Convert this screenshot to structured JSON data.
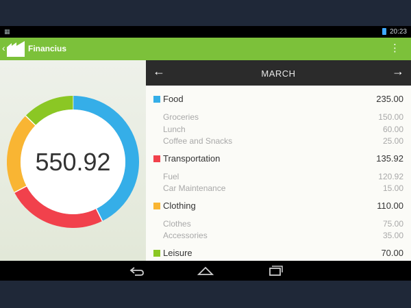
{
  "status": {
    "time": "20:23"
  },
  "app": {
    "title": "Financius"
  },
  "summary": {
    "total": "550.92"
  },
  "month": {
    "label": "MARCH"
  },
  "colors": {
    "food": "#35aee8",
    "transportation": "#f1414c",
    "clothing": "#f9b533",
    "leisure": "#8bc724",
    "action_bar": "#7cc13a"
  },
  "chart_data": {
    "type": "pie",
    "categories": [
      "Food",
      "Transportation",
      "Clothing",
      "Leisure"
    ],
    "values": [
      235.0,
      135.92,
      110.0,
      70.0
    ],
    "colors": [
      "#35aee8",
      "#f1414c",
      "#f9b533",
      "#8bc724"
    ]
  },
  "categories": [
    {
      "name": "Food",
      "amount": "235.00",
      "color": "#35aee8",
      "items": [
        {
          "name": "Groceries",
          "amount": "150.00"
        },
        {
          "name": "Lunch",
          "amount": "60.00"
        },
        {
          "name": "Coffee and Snacks",
          "amount": "25.00"
        }
      ]
    },
    {
      "name": "Transportation",
      "amount": "135.92",
      "color": "#f1414c",
      "items": [
        {
          "name": "Fuel",
          "amount": "120.92"
        },
        {
          "name": "Car Maintenance",
          "amount": "15.00"
        }
      ]
    },
    {
      "name": "Clothing",
      "amount": "110.00",
      "color": "#f9b533",
      "items": [
        {
          "name": "Clothes",
          "amount": "75.00"
        },
        {
          "name": "Accessories",
          "amount": "35.00"
        }
      ]
    },
    {
      "name": "Leisure",
      "amount": "70.00",
      "color": "#8bc724",
      "items": []
    }
  ]
}
